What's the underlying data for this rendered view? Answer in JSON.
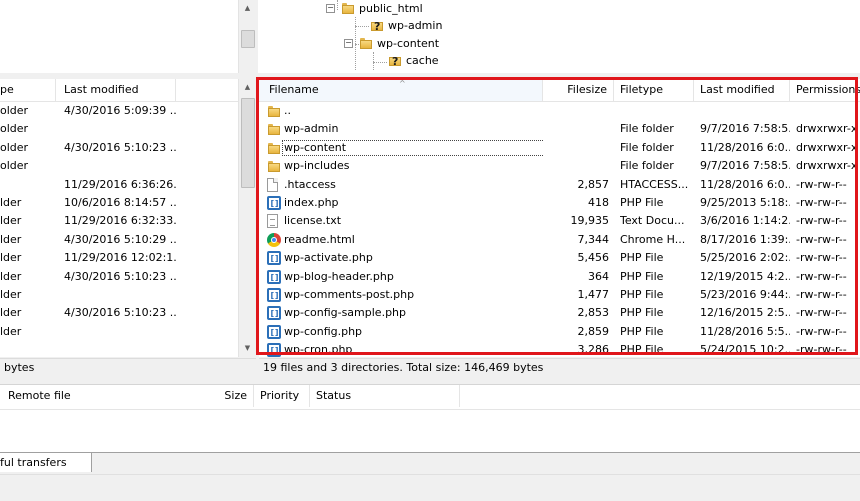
{
  "remote_tree": {
    "items": [
      {
        "label": "public_html",
        "type": "folder",
        "expanded": true
      },
      {
        "label": "wp-admin",
        "type": "unknown-folder"
      },
      {
        "label": "wp-content",
        "type": "folder",
        "expanded": true
      },
      {
        "label": "cache",
        "type": "unknown-folder"
      }
    ]
  },
  "local_list": {
    "headers": {
      "type": "pe",
      "modified": "Last modified"
    },
    "rows": [
      {
        "type": "older",
        "modified": "4/30/2016 5:09:39 ..."
      },
      {
        "type": "older",
        "modified": ""
      },
      {
        "type": "older",
        "modified": "4/30/2016 5:10:23 ..."
      },
      {
        "type": "older",
        "modified": ""
      },
      {
        "type": "",
        "modified": "11/29/2016 6:36:26..."
      },
      {
        "type": "lder",
        "modified": "10/6/2016 8:14:57 ..."
      },
      {
        "type": "lder",
        "modified": "11/29/2016 6:32:33..."
      },
      {
        "type": "lder",
        "modified": "4/30/2016 5:10:29 ..."
      },
      {
        "type": "lder",
        "modified": "11/29/2016 12:02:1..."
      },
      {
        "type": "lder",
        "modified": "4/30/2016 5:10:23 ..."
      },
      {
        "type": "lder",
        "modified": ""
      },
      {
        "type": "lder",
        "modified": "4/30/2016 5:10:23 ..."
      },
      {
        "type": "lder",
        "modified": ""
      }
    ],
    "status": "bytes"
  },
  "remote_list": {
    "headers": {
      "filename": "Filename",
      "filesize": "Filesize",
      "filetype": "Filetype",
      "modified": "Last modified",
      "permissions": "Permissions"
    },
    "rows": [
      {
        "name": "..",
        "size": "",
        "type": "",
        "modified": "",
        "perms": "",
        "icon": "folder-icon"
      },
      {
        "name": "wp-admin",
        "size": "",
        "type": "File folder",
        "modified": "9/7/2016 7:58:5...",
        "perms": "drwxrwxr-x",
        "icon": "folder-icon"
      },
      {
        "name": "wp-content",
        "size": "",
        "type": "File folder",
        "modified": "11/28/2016 6:0...",
        "perms": "drwxrwxr-x",
        "icon": "folder-icon",
        "focused": true
      },
      {
        "name": "wp-includes",
        "size": "",
        "type": "File folder",
        "modified": "9/7/2016 7:58:5...",
        "perms": "drwxrwxr-x",
        "icon": "folder-icon"
      },
      {
        "name": ".htaccess",
        "size": "2,857",
        "type": "HTACCESS...",
        "modified": "11/28/2016 6:0...",
        "perms": "-rw-rw-r--",
        "icon": "file-icon"
      },
      {
        "name": "index.php",
        "size": "418",
        "type": "PHP File",
        "modified": "9/25/2013 5:18:...",
        "perms": "-rw-rw-r--",
        "icon": "php-icon"
      },
      {
        "name": "license.txt",
        "size": "19,935",
        "type": "Text Docu...",
        "modified": "3/6/2016 1:14:2...",
        "perms": "-rw-rw-r--",
        "icon": "text-icon"
      },
      {
        "name": "readme.html",
        "size": "7,344",
        "type": "Chrome H...",
        "modified": "8/17/2016 1:39:...",
        "perms": "-rw-rw-r--",
        "icon": "chrome-icon"
      },
      {
        "name": "wp-activate.php",
        "size": "5,456",
        "type": "PHP File",
        "modified": "5/25/2016 2:02:...",
        "perms": "-rw-rw-r--",
        "icon": "php-icon"
      },
      {
        "name": "wp-blog-header.php",
        "size": "364",
        "type": "PHP File",
        "modified": "12/19/2015 4:2...",
        "perms": "-rw-rw-r--",
        "icon": "php-icon"
      },
      {
        "name": "wp-comments-post.php",
        "size": "1,477",
        "type": "PHP File",
        "modified": "5/23/2016 9:44:...",
        "perms": "-rw-rw-r--",
        "icon": "php-icon"
      },
      {
        "name": "wp-config-sample.php",
        "size": "2,853",
        "type": "PHP File",
        "modified": "12/16/2015 2:5...",
        "perms": "-rw-rw-r--",
        "icon": "php-icon"
      },
      {
        "name": "wp-config.php",
        "size": "2,859",
        "type": "PHP File",
        "modified": "11/28/2016 5:5...",
        "perms": "-rw-rw-r--",
        "icon": "php-icon"
      },
      {
        "name": "wp-cron.php",
        "size": "3,286",
        "type": "PHP File",
        "modified": "5/24/2015 10:2...",
        "perms": "-rw-rw-r--",
        "icon": "php-icon"
      }
    ],
    "status": "19 files and 3 directories. Total size: 146,469 bytes"
  },
  "queue": {
    "headers": {
      "remote_file": "Remote file",
      "size": "Size",
      "priority": "Priority",
      "status": "Status"
    },
    "tab_label": "ful transfers"
  },
  "colors": {
    "highlight_border": "#e0161b",
    "selection_accent": "#3399ff"
  }
}
